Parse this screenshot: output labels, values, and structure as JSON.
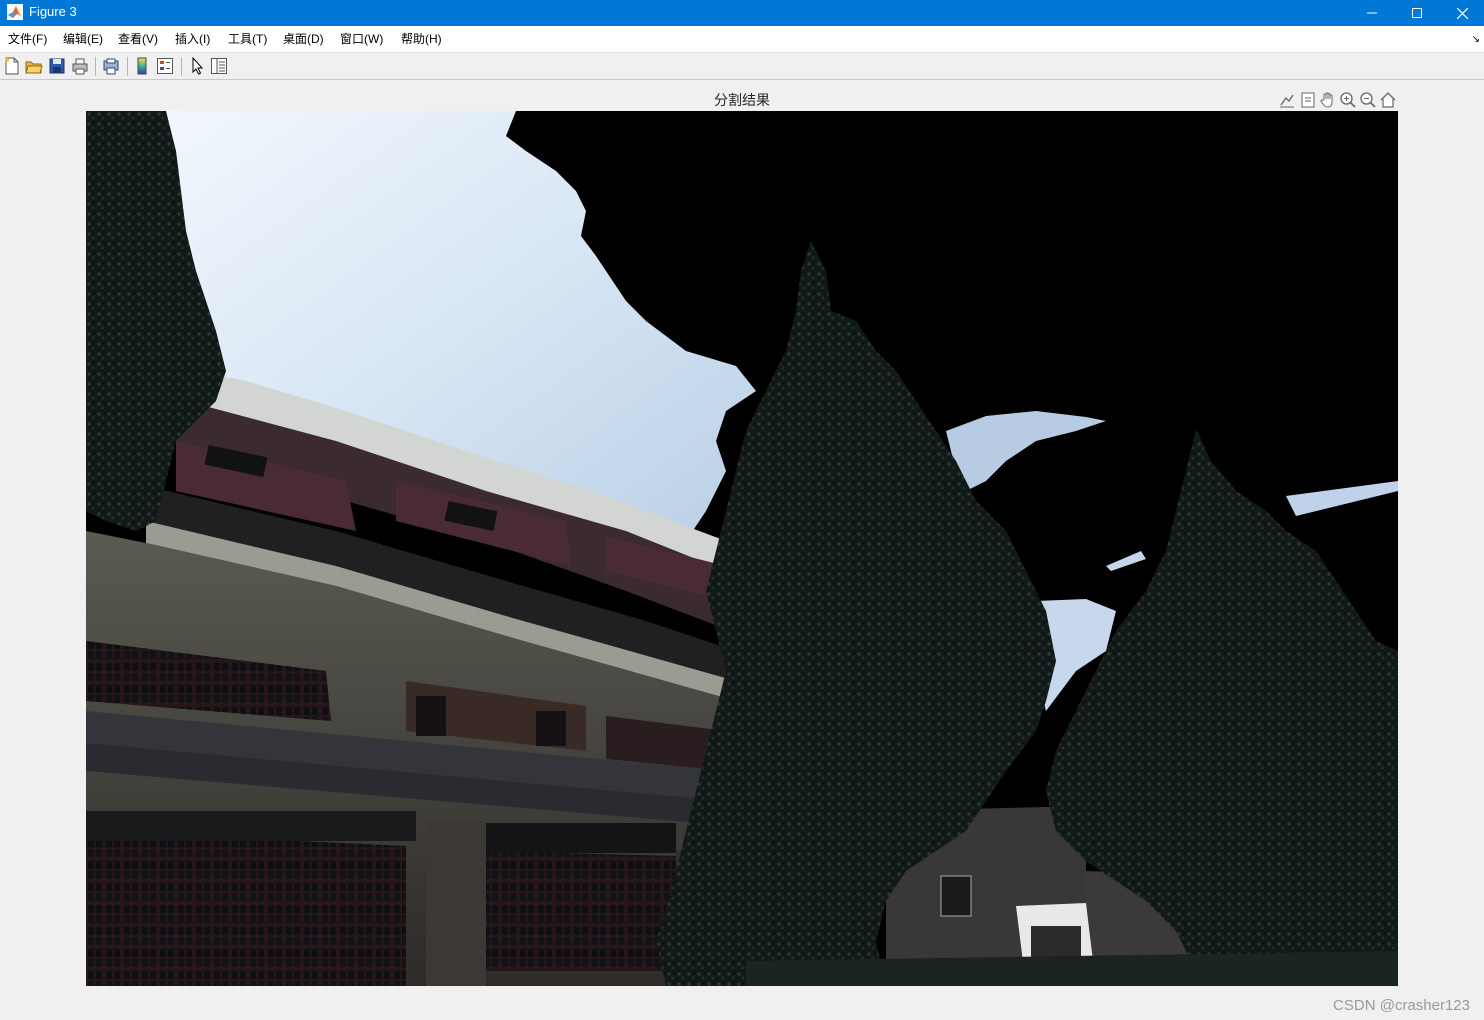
{
  "window": {
    "title": "Figure 3"
  },
  "menu": [
    {
      "label": "文件(F)"
    },
    {
      "label": "编辑(E)"
    },
    {
      "label": "查看(V)"
    },
    {
      "label": "插入(I)"
    },
    {
      "label": "工具(T)"
    },
    {
      "label": "桌面(D)"
    },
    {
      "label": "窗口(W)"
    },
    {
      "label": "帮助(H)"
    }
  ],
  "toolbar": {
    "icons": [
      "new-figure-icon",
      "open-file-icon",
      "save-icon",
      "print-icon",
      "print-preview-icon",
      "colorbar-icon",
      "legend-icon",
      "edit-pointer-icon",
      "property-inspector-icon"
    ]
  },
  "axes": {
    "title": "分割结果",
    "tools": [
      "export-icon",
      "brush-icon",
      "pan-icon",
      "zoom-in-icon",
      "zoom-out-icon",
      "home-icon"
    ]
  },
  "watermark": "CSDN @crasher123",
  "colors": {
    "titlebar": "#0078d7",
    "figure_bg": "#f0f0f0",
    "masked_region": "#000000"
  }
}
